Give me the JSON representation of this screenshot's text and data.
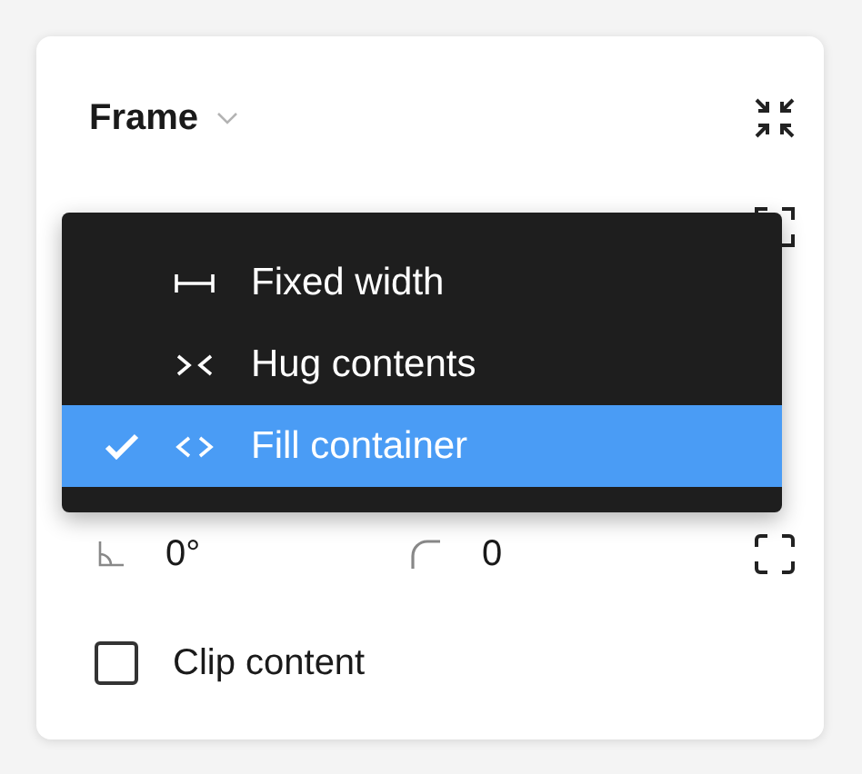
{
  "panel": {
    "title": "Frame"
  },
  "rotation": {
    "value": "0°"
  },
  "corner_radius": {
    "value": "0"
  },
  "clip_content": {
    "label": "Clip content",
    "checked": false
  },
  "resize_menu": [
    {
      "kind": "fixed",
      "label": "Fixed width",
      "selected": false
    },
    {
      "kind": "hug",
      "label": "Hug contents",
      "selected": false
    },
    {
      "kind": "fill",
      "label": "Fill container",
      "selected": true
    }
  ]
}
